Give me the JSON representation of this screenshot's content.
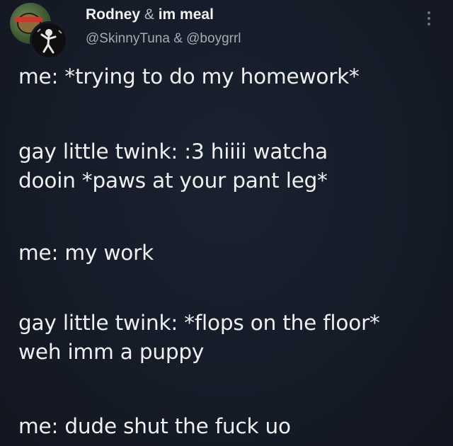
{
  "tweet": {
    "display_name_1": "Rodney",
    "amp_separator": "&",
    "display_name_2": "im meal",
    "handles": "@SkinnyTuna & @boygrrl",
    "paragraphs": [
      "me: *trying to do my homework*",
      "gay little twink: :3 hiiii watcha\ndooin *paws at your pant leg*",
      "me: my work",
      "gay little twink: *flops on the floor*\nweh imm a puppy",
      "me: dude shut the fuck uo"
    ]
  },
  "icons": {
    "avatar_primary": "turtle-avatar-icon",
    "avatar_secondary": "dancing-figure-avatar-icon",
    "more": "more-options-icon"
  },
  "colors": {
    "background": "#151b27",
    "text": "#f0f0f0",
    "secondary_text": "#a5abb3"
  }
}
